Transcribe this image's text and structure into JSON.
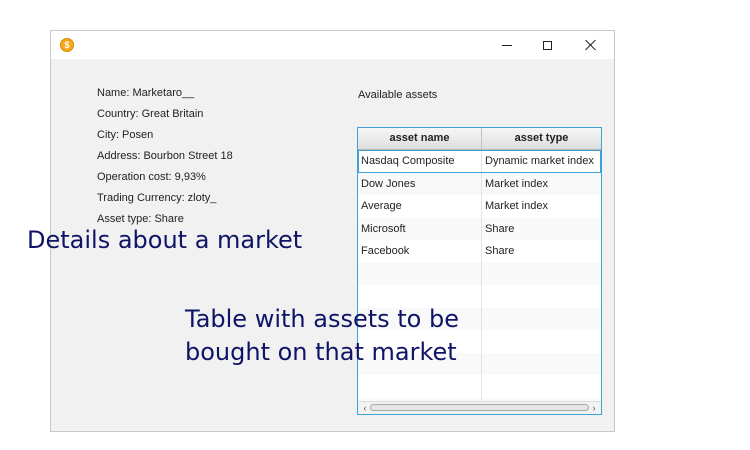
{
  "window": {
    "icon": "coin-icon",
    "controls": [
      "minimize-icon",
      "maximize-icon",
      "close-icon"
    ]
  },
  "details": {
    "lines": [
      "Name: Marketaro__",
      "Country: Great Britain",
      "City: Posen",
      "Address: Bourbon Street 18",
      "Operation cost: 9,93%",
      "Trading Currency: zloty_",
      "Asset type: Share"
    ]
  },
  "assets": {
    "label": "Available assets",
    "headers": [
      "asset name",
      "asset type"
    ],
    "rows": [
      [
        "Nasdaq Composite",
        "Dynamic market index"
      ],
      [
        "Dow Jones",
        "Market index"
      ],
      [
        "Average",
        "Market index"
      ],
      [
        "Microsoft",
        "Share"
      ],
      [
        "Facebook",
        "Share"
      ],
      [
        "",
        ""
      ],
      [
        "",
        ""
      ],
      [
        "",
        ""
      ],
      [
        "",
        ""
      ],
      [
        "",
        ""
      ],
      [
        "",
        ""
      ],
      [
        "",
        ""
      ]
    ],
    "selected_row": 0
  },
  "annotations": {
    "details_caption": "Details about a market",
    "table_caption_line1": "Table with assets to be",
    "table_caption_line2": "bought on that market"
  },
  "colors": {
    "annotation": "#0f1466",
    "table_border": "#3fa0d8",
    "app_icon": "#f4a81d"
  }
}
